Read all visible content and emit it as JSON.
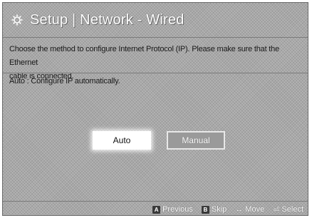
{
  "header": {
    "title": "Setup | Network - Wired",
    "icon": "gear-icon"
  },
  "description": {
    "line1": "Choose the method to configure Internet Protocol (IP). Please make sure that the Ethernet",
    "line2": "cable is connected."
  },
  "hint": "Auto : Configure IP automatically.",
  "buttons": {
    "auto_label": "Auto",
    "manual_label": "Manual",
    "selected": "Auto"
  },
  "footer": {
    "previous": {
      "key": "A",
      "label": "Previous"
    },
    "skip": {
      "key": "B",
      "label": "Skip"
    },
    "move": {
      "glyph": "↔",
      "label": "Move"
    },
    "select": {
      "glyph": "⏎",
      "label": "Select"
    }
  },
  "colors": {
    "background": "#a8a8a8",
    "title_text": "#ffffff",
    "selected_button": "#ffffff",
    "unselected_button": "#9a9a9a"
  }
}
